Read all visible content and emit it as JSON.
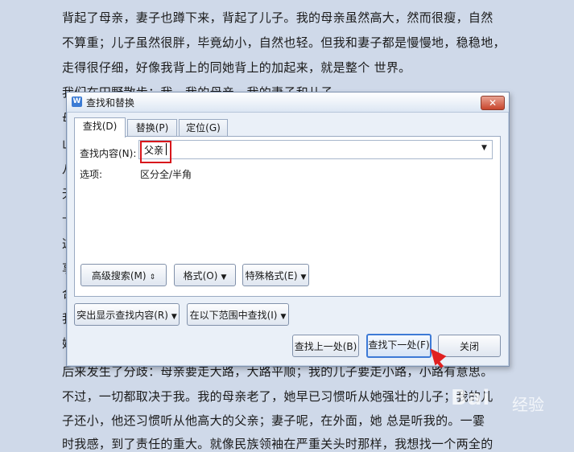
{
  "document": {
    "lines": [
      "背起了母亲，妻子也蹲下来，背起了儿子。我的母亲虽然高大，然而很瘦，自然",
      "不算重；儿子虽然很胖，毕竟幼小，自然也轻。但我和妻子都是慢慢地，稳稳地，",
      "走得很仔细，好像我背上的同她背上的加起来，就是整个 世界。",
      "我们在田野散步：我，我的母亲，我的妻子和儿子。",
      "后来发生了分歧：母亲要走大路，大路平顺；我的儿子要走小路，小路有意思。",
      "不过，一切都取决于我。我的母亲老了，她早已习惯听从她强壮的儿子；我的儿",
      "子还小，他还习惯听从他高大的父亲；妻子呢，在外面，她 总是听我的。一霎",
      "时我感，到了责任的重大。就像民族领袖在严重关头时那样，我想找一个两全的"
    ],
    "left_fragments": [
      "母",
      "山",
      "八",
      "无",
      "—",
      "这",
      "享",
      "合",
      "我",
      "妈"
    ]
  },
  "dialog": {
    "title": "查找和替换",
    "app_icon": "W",
    "close_glyph": "✕",
    "tabs": [
      "查找(D)",
      "替换(P)",
      "定位(G)"
    ],
    "find_label": "查找内容(N):",
    "find_value": "父亲",
    "options_label": "选项:",
    "options_value": "区分全/半角",
    "buttons": {
      "advanced": "高级搜索(M)",
      "format": "格式(O)",
      "special": "特殊格式(E)",
      "highlight": "突出显示查找内容(R)",
      "scope": "在以下范围中查找(I)",
      "find_prev": "查找上一处(B)",
      "find_next": "查找下一处(F)",
      "close": "关闭"
    },
    "arrow_glyph": "▼",
    "double_arrow_glyph": "⇕"
  },
  "watermark": {
    "text": "Bai",
    "sub": "经验"
  },
  "colors": {
    "page_bg": "#cfd9e9",
    "highlight_box": "#d8161b",
    "focus_border": "#3d7ad6"
  }
}
